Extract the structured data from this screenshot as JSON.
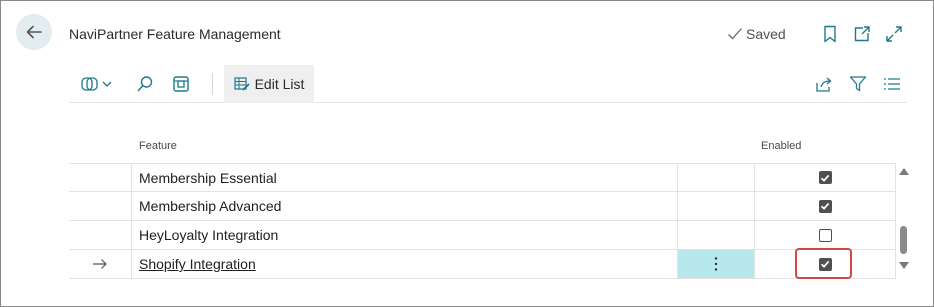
{
  "header": {
    "title": "NaviPartner Feature Management",
    "status": "Saved"
  },
  "toolbar": {
    "edit_list_label": "Edit List"
  },
  "columns": {
    "feature": "Feature",
    "enabled": "Enabled"
  },
  "rows": [
    {
      "feature": "Membership Essential",
      "enabled": true
    },
    {
      "feature": "Membership Advanced",
      "enabled": true
    },
    {
      "feature": "HeyLoyalty Integration",
      "enabled": false
    },
    {
      "feature": "Shopify Integration",
      "enabled": true,
      "selected": true
    }
  ],
  "colors": {
    "accent_back": "#e3ecee",
    "selected_cell": "#b6e8ee",
    "highlight_border": "#d64545"
  }
}
